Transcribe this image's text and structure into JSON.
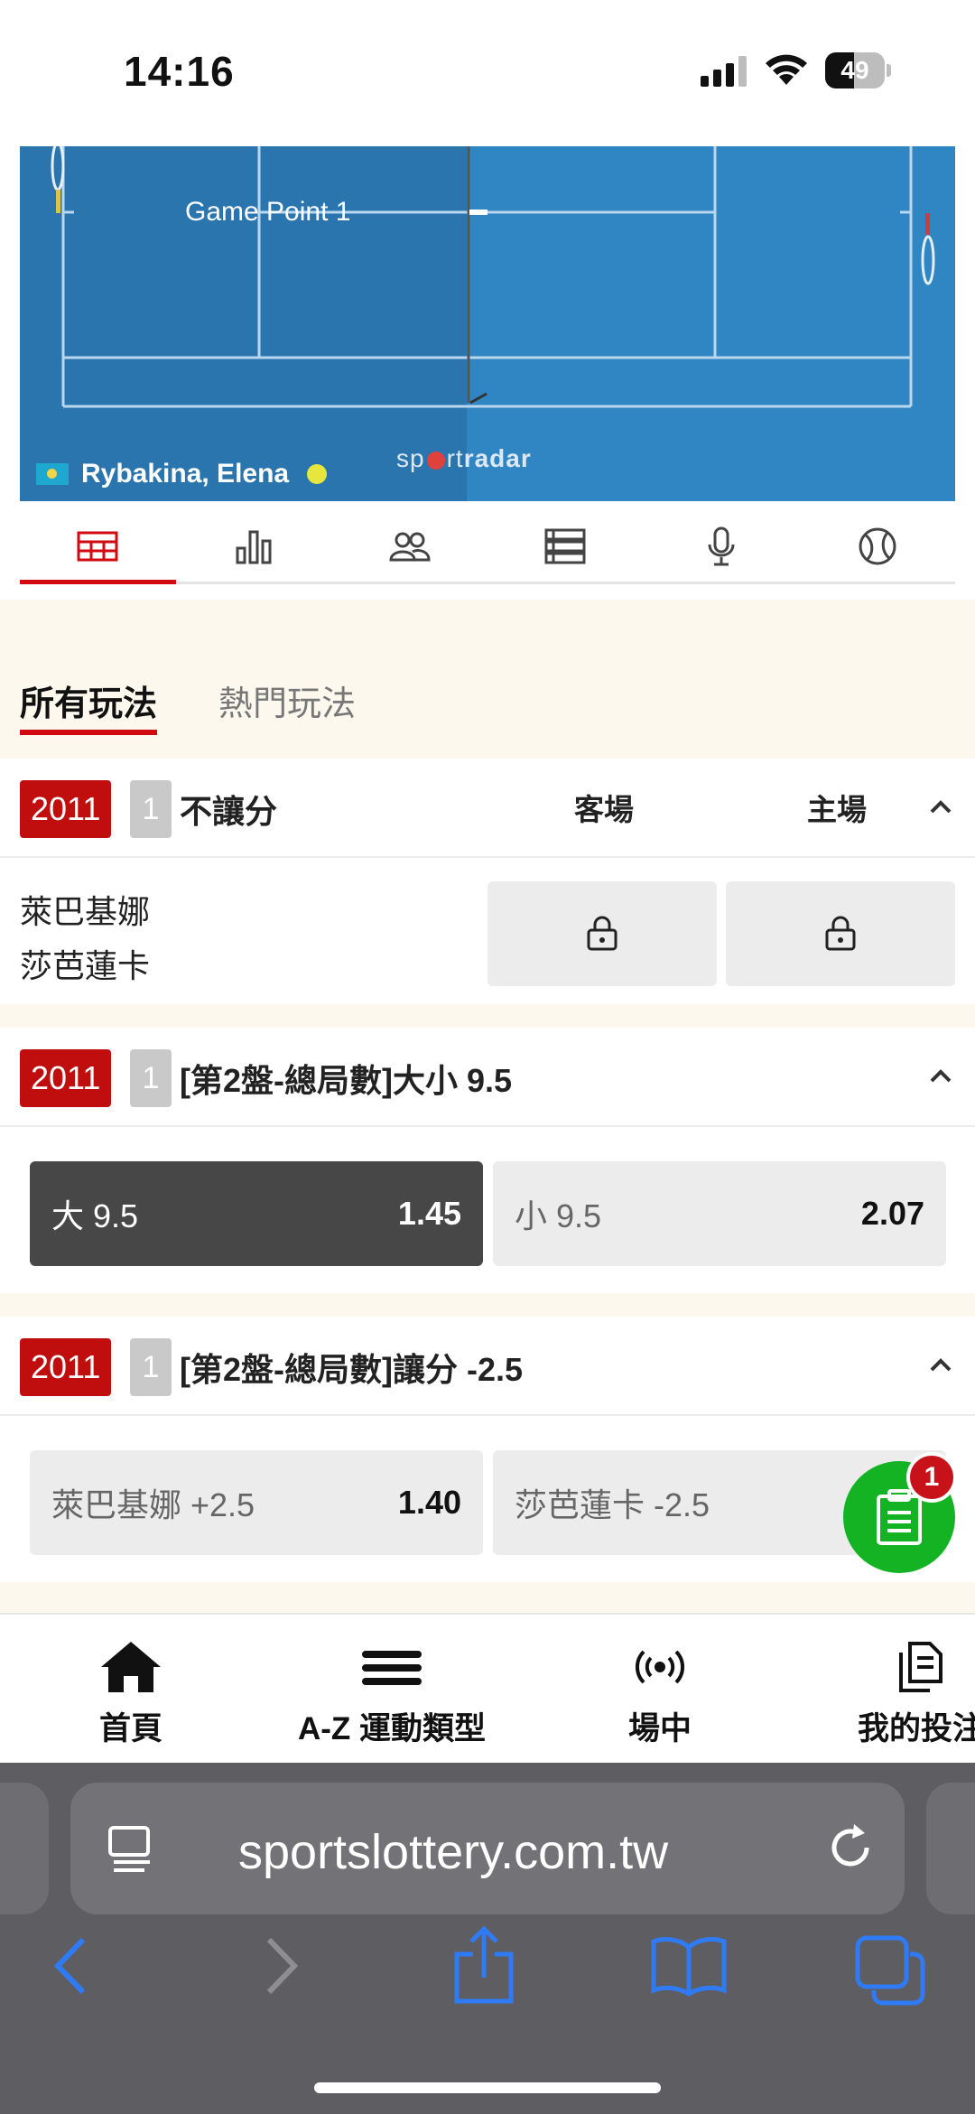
{
  "status_bar": {
    "time": "14:16",
    "battery": "49",
    "battery_level": 0.49
  },
  "scoreboard": {
    "game_point": "Game Point 1",
    "player": "Rybakina, Elena",
    "brand_a": "sp",
    "brand_b": "rt",
    "brand_c": "radar"
  },
  "icon_tabs": [
    "table-icon",
    "stats-icon",
    "players-icon",
    "list-icon",
    "microphone-icon",
    "tennis-ball-icon"
  ],
  "market_tabs": {
    "all": "所有玩法",
    "popular": "熱門玩法"
  },
  "markets": [
    {
      "code": "2011",
      "seq": "1",
      "title": "不讓分",
      "col_away": "客場",
      "col_home": "主場",
      "team_a": "萊巴基娜",
      "team_b": "莎芭蓮卡"
    },
    {
      "code": "2011",
      "seq": "1",
      "title": "[第2盤-總局數]大小 9.5",
      "options": [
        {
          "label": "大 9.5",
          "odds": "1.45",
          "selected": true
        },
        {
          "label": "小 9.5",
          "odds": "2.07",
          "selected": false
        }
      ]
    },
    {
      "code": "2011",
      "seq": "1",
      "title": "[第2盤-總局數]讓分 -2.5",
      "options": [
        {
          "label": "萊巴基娜 +2.5",
          "odds": "1.40",
          "selected": false
        },
        {
          "label": "莎芭蓮卡 -2.5",
          "odds": "",
          "selected": false
        }
      ]
    }
  ],
  "bet_slip": {
    "count": "1"
  },
  "bottom_nav": [
    {
      "label": "首頁",
      "icon": "home-icon"
    },
    {
      "label": "A-Z 運動類型",
      "icon": "menu-icon"
    },
    {
      "label": "場中",
      "icon": "live-icon"
    },
    {
      "label": "我的投注",
      "icon": "bets-icon"
    }
  ],
  "browser": {
    "url": "sportslottery.com.tw"
  },
  "colors": {
    "accent": "#d10a12",
    "code_badge": "#c00d0d",
    "fab": "#14b323",
    "court": "#2d7fba"
  }
}
